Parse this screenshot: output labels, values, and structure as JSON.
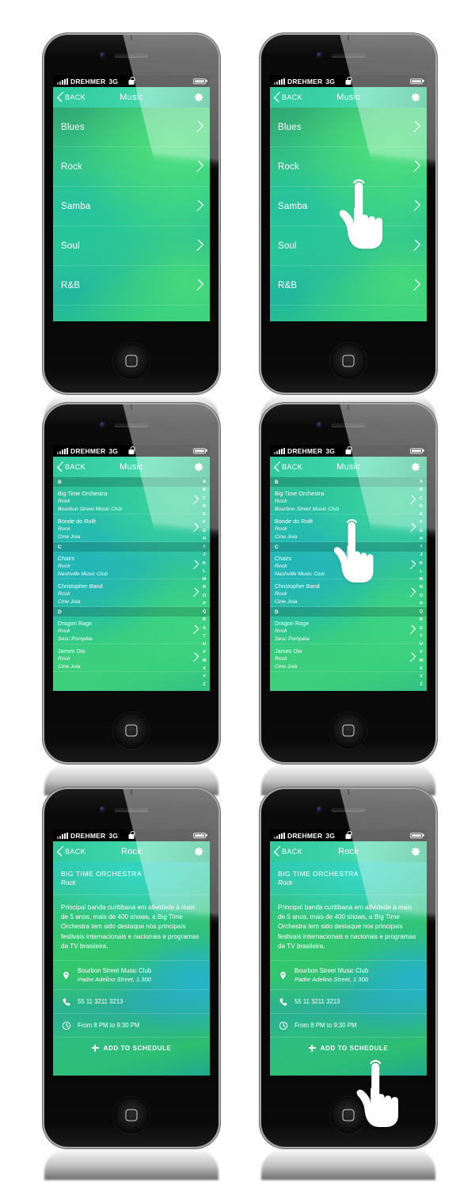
{
  "meta": {
    "page_background": "#ffffff",
    "accent_green": "#3ad1a6",
    "screen_gradient": "green-teal-blend"
  },
  "status_bar": {
    "carrier": "DREHMER",
    "network": "3G",
    "lock_icon": "lock-icon",
    "battery_icon": "battery-icon",
    "signal_icon": "signal-bars-icon"
  },
  "nav": {
    "back_label": "BACK",
    "back_icon": "chevron-left-icon",
    "settings_icon": "gear-icon",
    "title_music": "Music",
    "title_rock": "Rock"
  },
  "genre_screen": {
    "items": [
      {
        "label": "Blues",
        "chevron": "chevron-right-icon"
      },
      {
        "label": "Rock",
        "chevron": "chevron-right-icon"
      },
      {
        "label": "Samba",
        "chevron": "chevron-right-icon"
      },
      {
        "label": "Soul",
        "chevron": "chevron-right-icon"
      },
      {
        "label": "R&B",
        "chevron": "chevron-right-icon"
      }
    ]
  },
  "band_screen": {
    "sections": [
      {
        "letter": "B",
        "bands": [
          {
            "name": "Big Time Orchestra",
            "genre": "Rock",
            "venue": "Bourbon Street Music Club"
          },
          {
            "name": "Bonde do Rolê",
            "genre": "Rock",
            "venue": "Cine Joia"
          }
        ]
      },
      {
        "letter": "C",
        "bands": [
          {
            "name": "Chairs",
            "genre": "Rock",
            "venue": "Nashville Music Club"
          },
          {
            "name": "Christopher Band",
            "genre": "Rock",
            "venue": "Cine Joia"
          }
        ]
      },
      {
        "letter": "D",
        "bands": [
          {
            "name": "Dragon Rage",
            "genre": "Rock",
            "venue": "Sesc Pompéia"
          },
          {
            "name": "James Dio",
            "genre": "Rock",
            "venue": "Cine Joia"
          }
        ]
      }
    ],
    "alpha_index": [
      "A",
      "B",
      "C",
      "D",
      "E",
      "F",
      "G",
      "H",
      "I",
      "J",
      "K",
      "L",
      "M",
      "N",
      "O",
      "P",
      "Q",
      "R",
      "S",
      "T",
      "U",
      "V",
      "W",
      "X",
      "Y",
      "Z"
    ]
  },
  "detail_screen": {
    "band_name": "BIG TIME ORCHESTRA",
    "genre": "Rock",
    "description": "Principal banda curitibana em atividade  à mais de 5 anos, mais de 400 shows, a Big Time Orchestra tem sido destaque nos principais festivais internacionais e nacionais e programas da TV brasileira.",
    "venue": {
      "icon": "map-pin-icon",
      "name": "Bourbon Street Music Club",
      "address": "Padre Adelino Street, 1.300"
    },
    "phone": {
      "icon": "phone-icon",
      "number": "55 11 3211 3213"
    },
    "time": {
      "icon": "clock-icon",
      "value": "From 8 PM to 9:30 PM"
    },
    "add_button": {
      "icon": "plus-icon",
      "label": "ADD TO SCHEDULE"
    }
  },
  "cursors": {
    "hand_icon": "pointing-hand-cursor"
  }
}
